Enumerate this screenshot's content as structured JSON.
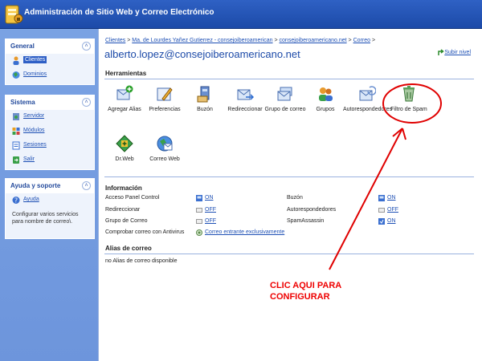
{
  "app": {
    "title": "Administración de Sitio Web y Correo Electrónico"
  },
  "sidebar": {
    "general": {
      "title": "General",
      "items": [
        {
          "label": "Clientes"
        },
        {
          "label": "Dominios"
        }
      ]
    },
    "sistema": {
      "title": "Sistema",
      "items": [
        {
          "label": "Servidor"
        },
        {
          "label": "Módulos"
        },
        {
          "label": "Sesiones"
        },
        {
          "label": "Salir"
        }
      ]
    },
    "ayuda": {
      "title": "Ayuda y soporte",
      "items": [
        {
          "label": "Ayuda"
        }
      ],
      "description": "Configurar varios servicios para nombre de correo\\."
    }
  },
  "breadcrumb": {
    "items": [
      "Clientes",
      "Ma. de Lourdes Yañez Gutierrez - consejoiberoamerican",
      "consejoiberoamericano.net",
      "Correo"
    ],
    "separator": ">"
  },
  "page": {
    "title": "alberto.lopez@consejoiberoamericano.net",
    "up_link": "Subir nivel"
  },
  "tools": {
    "title": "Herramientas",
    "items": [
      {
        "label": "Agregar Alias",
        "icon": "add-alias-icon"
      },
      {
        "label": "Preferencias",
        "icon": "preferences-icon"
      },
      {
        "label": "Buzón",
        "icon": "mailbox-icon"
      },
      {
        "label": "Redireccionar",
        "icon": "redirect-icon"
      },
      {
        "label": "Grupo de correo",
        "icon": "mail-group-icon"
      },
      {
        "label": "Grupos",
        "icon": "groups-icon"
      },
      {
        "label": "Autorespondedores",
        "icon": "autoresponder-icon"
      },
      {
        "label": "Filtro de Spam",
        "icon": "spam-filter-icon"
      },
      {
        "label": "Dr.Web",
        "icon": "drweb-icon"
      },
      {
        "label": "Correo Web",
        "icon": "webmail-icon"
      }
    ]
  },
  "info": {
    "title": "Información",
    "left": [
      {
        "label": "Acceso Panel Control",
        "value": "ON"
      },
      {
        "label": "Redireccionar",
        "value": "OFF"
      },
      {
        "label": "Grupo de Correo",
        "value": "OFF"
      },
      {
        "label": "Comprobar correo con Antivirus",
        "value": "Correo entrante exclusivamente"
      }
    ],
    "right": [
      {
        "label": "Buzón",
        "value": "ON"
      },
      {
        "label": "Autorespondedores",
        "value": "OFF"
      },
      {
        "label": "SpamAssassin",
        "value": "ON"
      }
    ]
  },
  "aliases": {
    "title": "Alias de correo",
    "empty_text": "no Alias de correo disponible"
  },
  "annotation": {
    "line1": "CLIC AQUI PARA",
    "line2": "CONFIGURAR",
    "color": "#e00000"
  }
}
